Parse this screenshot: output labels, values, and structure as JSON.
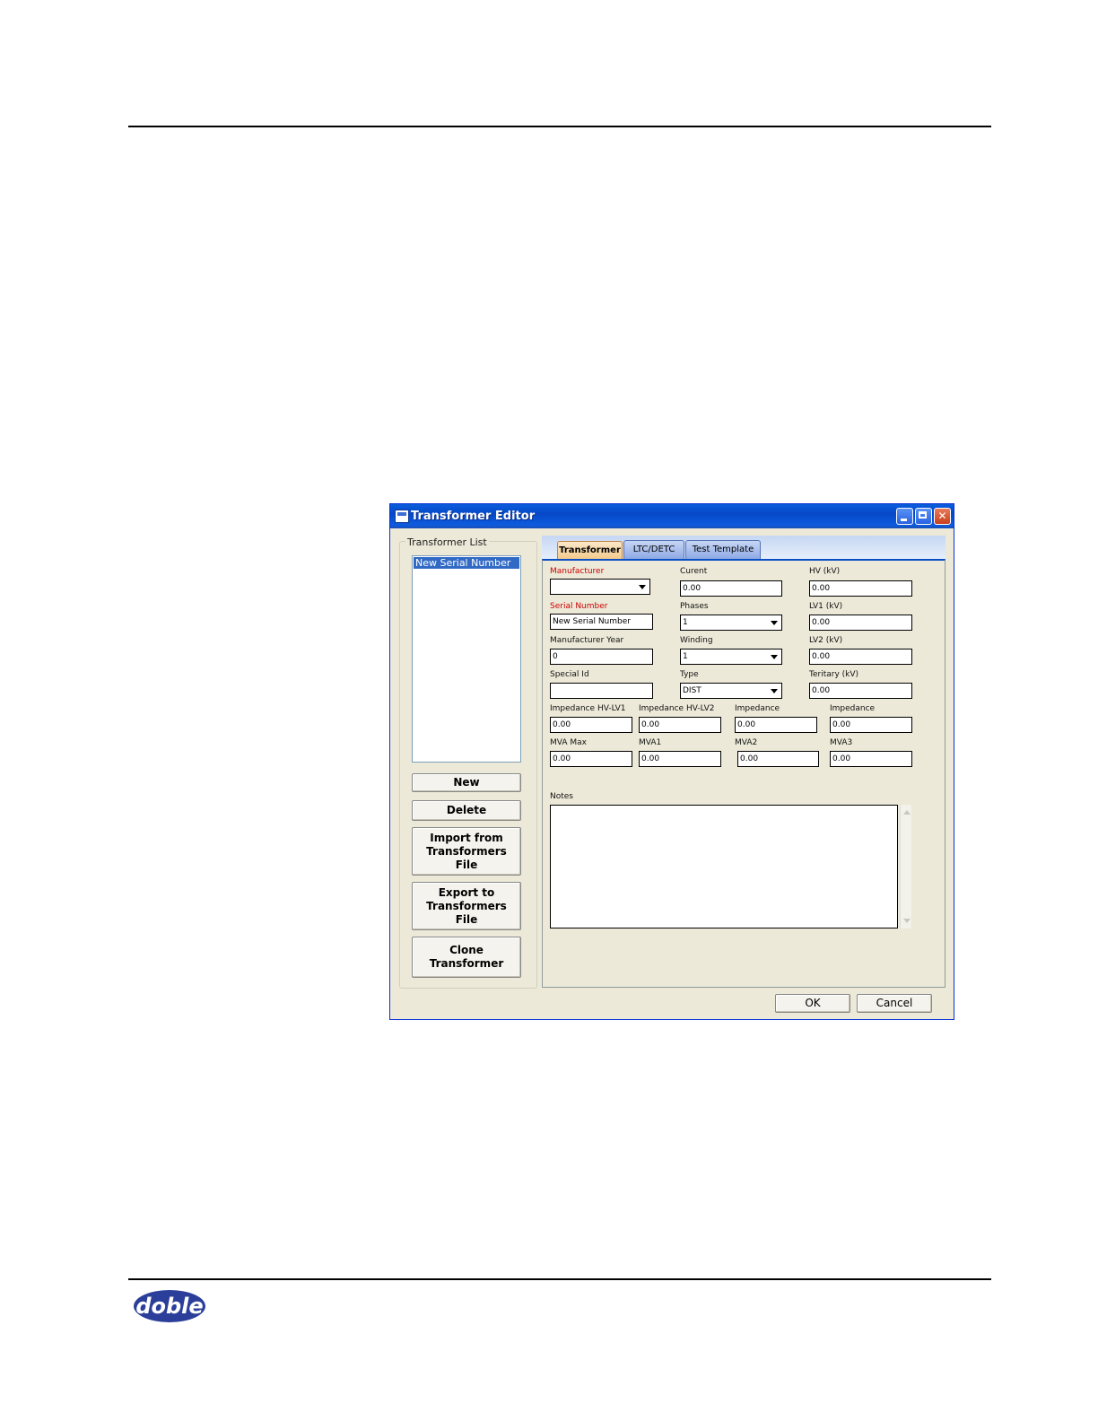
{
  "logo": {
    "text": "doble"
  },
  "window": {
    "title": "Transformer Editor"
  },
  "transformer_list": {
    "label": "Transformer List",
    "items": [
      "New Serial Number"
    ],
    "selected": "New Serial Number"
  },
  "buttons": {
    "new": "New",
    "delete": "Delete",
    "import": "Import from\nTransformers\nFile",
    "export": "Export to\nTransformers\nFile",
    "clone": "Clone\nTransformer",
    "ok": "OK",
    "cancel": "Cancel"
  },
  "tabs": [
    {
      "label": "Transformer",
      "active": true
    },
    {
      "label": "LTC/DETC",
      "active": false
    },
    {
      "label": "Test Template",
      "active": false
    }
  ],
  "form": {
    "manufacturer": {
      "label": "Manufacturer",
      "value": ""
    },
    "current": {
      "label": "Curent",
      "value": "0.00"
    },
    "hv": {
      "label": "HV (kV)",
      "value": "0.00"
    },
    "serial_number": {
      "label": "Serial Number",
      "value": "New Serial Number"
    },
    "phases": {
      "label": "Phases",
      "value": "1"
    },
    "lv1": {
      "label": "LV1 (kV)",
      "value": "0.00"
    },
    "manufacturer_year": {
      "label": "Manufacturer Year",
      "value": "0"
    },
    "winding": {
      "label": "Winding",
      "value": "1"
    },
    "lv2": {
      "label": "LV2 (kV)",
      "value": "0.00"
    },
    "special_id": {
      "label": "Special Id",
      "value": ""
    },
    "type": {
      "label": "Type",
      "value": "DIST"
    },
    "tertiary": {
      "label": "Teritary (kV)",
      "value": "0.00"
    },
    "impedance_hv_lv1": {
      "label": "Impedance HV-LV1",
      "value": "0.00"
    },
    "impedance_hv_lv2": {
      "label": "Impedance HV-LV2",
      "value": "0.00"
    },
    "impedance_3": {
      "label": "Impedance",
      "value": "0.00"
    },
    "impedance_4": {
      "label": "Impedance",
      "value": "0.00"
    },
    "mva_max": {
      "label": "MVA Max",
      "value": "0.00"
    },
    "mva1": {
      "label": "MVA1",
      "value": "0.00"
    },
    "mva2": {
      "label": "MVA2",
      "value": "0.00"
    },
    "mva3": {
      "label": "MVA3",
      "value": "0.00"
    },
    "notes": {
      "label": "Notes",
      "value": ""
    }
  }
}
